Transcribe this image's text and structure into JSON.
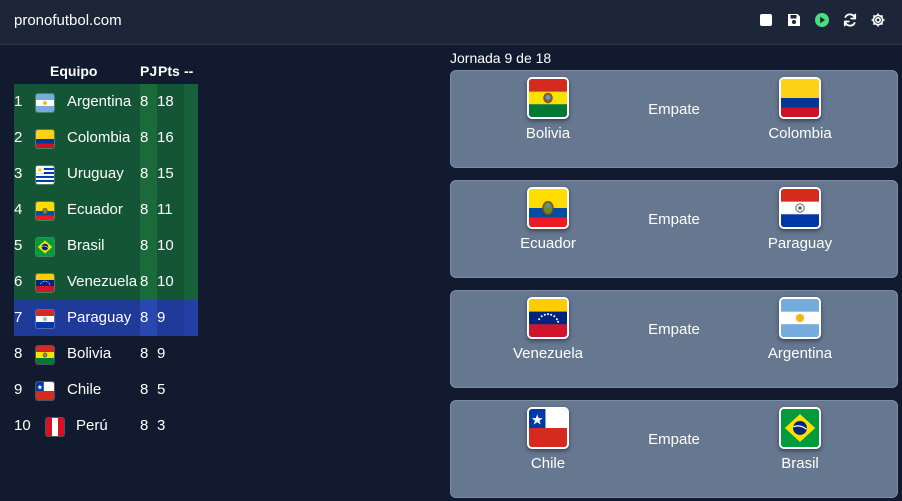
{
  "header": {
    "brand": "pronofutbol.com",
    "icons": [
      "checkbox-icon",
      "save-icon",
      "play-icon",
      "refresh-icon",
      "settings-icon"
    ],
    "colors": {
      "background": "#1d2638",
      "play": "#4ade80"
    }
  },
  "standings": {
    "headers": {
      "team": "Equipo",
      "pj": "PJ",
      "pts": "Pts",
      "extra": "--"
    },
    "rows": [
      {
        "pos": "1",
        "name": "Argentina",
        "flag": "argentina-flag-icon",
        "pj": "8",
        "pts": "18",
        "zone": "green"
      },
      {
        "pos": "2",
        "name": "Colombia",
        "flag": "colombia-flag-icon",
        "pj": "8",
        "pts": "16",
        "zone": "green"
      },
      {
        "pos": "3",
        "name": "Uruguay",
        "flag": "uruguay-flag-icon",
        "pj": "8",
        "pts": "15",
        "zone": "green"
      },
      {
        "pos": "4",
        "name": "Ecuador",
        "flag": "ecuador-flag-icon",
        "pj": "8",
        "pts": "11",
        "zone": "green"
      },
      {
        "pos": "5",
        "name": "Brasil",
        "flag": "brazil-flag-icon",
        "pj": "8",
        "pts": "10",
        "zone": "green"
      },
      {
        "pos": "6",
        "name": "Venezuela",
        "flag": "venezuela-flag-icon",
        "pj": "8",
        "pts": "10",
        "zone": "green"
      },
      {
        "pos": "7",
        "name": "Paraguay",
        "flag": "paraguay-flag-icon",
        "pj": "8",
        "pts": "9",
        "zone": "blue"
      },
      {
        "pos": "8",
        "name": "Bolivia",
        "flag": "bolivia-flag-icon",
        "pj": "8",
        "pts": "9",
        "zone": "none"
      },
      {
        "pos": "9",
        "name": "Chile",
        "flag": "chile-flag-icon",
        "pj": "8",
        "pts": "5",
        "zone": "none"
      },
      {
        "pos": "10",
        "name": "Perú",
        "flag": "peru-flag-icon",
        "pj": "8",
        "pts": "3",
        "zone": "none"
      }
    ],
    "zone_colors": {
      "green": "#135534",
      "blue": "#1f3a98"
    }
  },
  "round": {
    "title": "Jornada 9 de 18",
    "matches": [
      {
        "home": "Bolivia",
        "home_flag": "bolivia-flag-icon",
        "result": "Empate",
        "away": "Colombia",
        "away_flag": "colombia-flag-icon"
      },
      {
        "home": "Ecuador",
        "home_flag": "ecuador-flag-icon",
        "result": "Empate",
        "away": "Paraguay",
        "away_flag": "paraguay-flag-icon"
      },
      {
        "home": "Venezuela",
        "home_flag": "venezuela-flag-icon",
        "result": "Empate",
        "away": "Argentina",
        "away_flag": "argentina-flag-icon"
      },
      {
        "home": "Chile",
        "home_flag": "chile-flag-icon",
        "result": "Empate",
        "away": "Brasil",
        "away_flag": "brazil-flag-icon"
      }
    ],
    "card_color": "#667790"
  }
}
